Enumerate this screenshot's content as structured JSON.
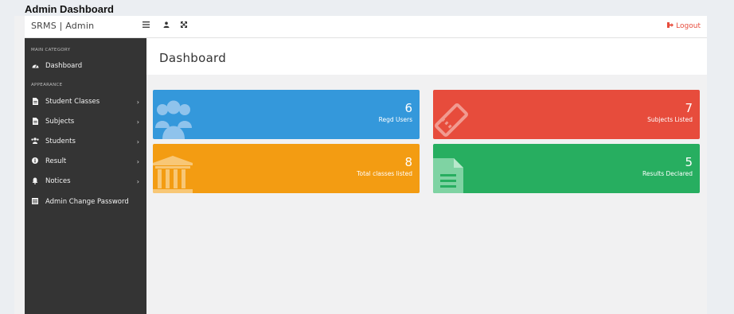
{
  "page": {
    "caption": "Admin Dashboard"
  },
  "topbar": {
    "brand": "SRMS | Admin",
    "icons": [
      "menu-icon",
      "user-icon",
      "expand-icon"
    ],
    "logout_label": "Logout"
  },
  "sidebar": {
    "categories": [
      "MAIN CATEGORY",
      "APPEARANCE"
    ],
    "items": [
      {
        "label": "Dashboard",
        "icon": "dashboard-icon",
        "has_submenu": false
      },
      {
        "label": "Student Classes",
        "icon": "file-icon",
        "has_submenu": true
      },
      {
        "label": "Subjects",
        "icon": "file-icon",
        "has_submenu": true
      },
      {
        "label": "Students",
        "icon": "users-icon",
        "has_submenu": true
      },
      {
        "label": "Result",
        "icon": "info-icon",
        "has_submenu": true
      },
      {
        "label": "Notices",
        "icon": "bell-icon",
        "has_submenu": true
      },
      {
        "label": "Admin Change Password",
        "icon": "list-icon",
        "has_submenu": false
      }
    ]
  },
  "main": {
    "title": "Dashboard",
    "cards": [
      {
        "value": "6",
        "label": "Regd Users",
        "color": "#3498db",
        "icon": "users-icon"
      },
      {
        "value": "7",
        "label": "Subjects Listed",
        "color": "#e74c3c",
        "icon": "ticket-icon"
      },
      {
        "value": "8",
        "label": "Total classes listed",
        "color": "#f39c12",
        "icon": "bank-icon"
      },
      {
        "value": "5",
        "label": "Results Declared",
        "color": "#27ae60",
        "icon": "document-icon"
      }
    ]
  }
}
